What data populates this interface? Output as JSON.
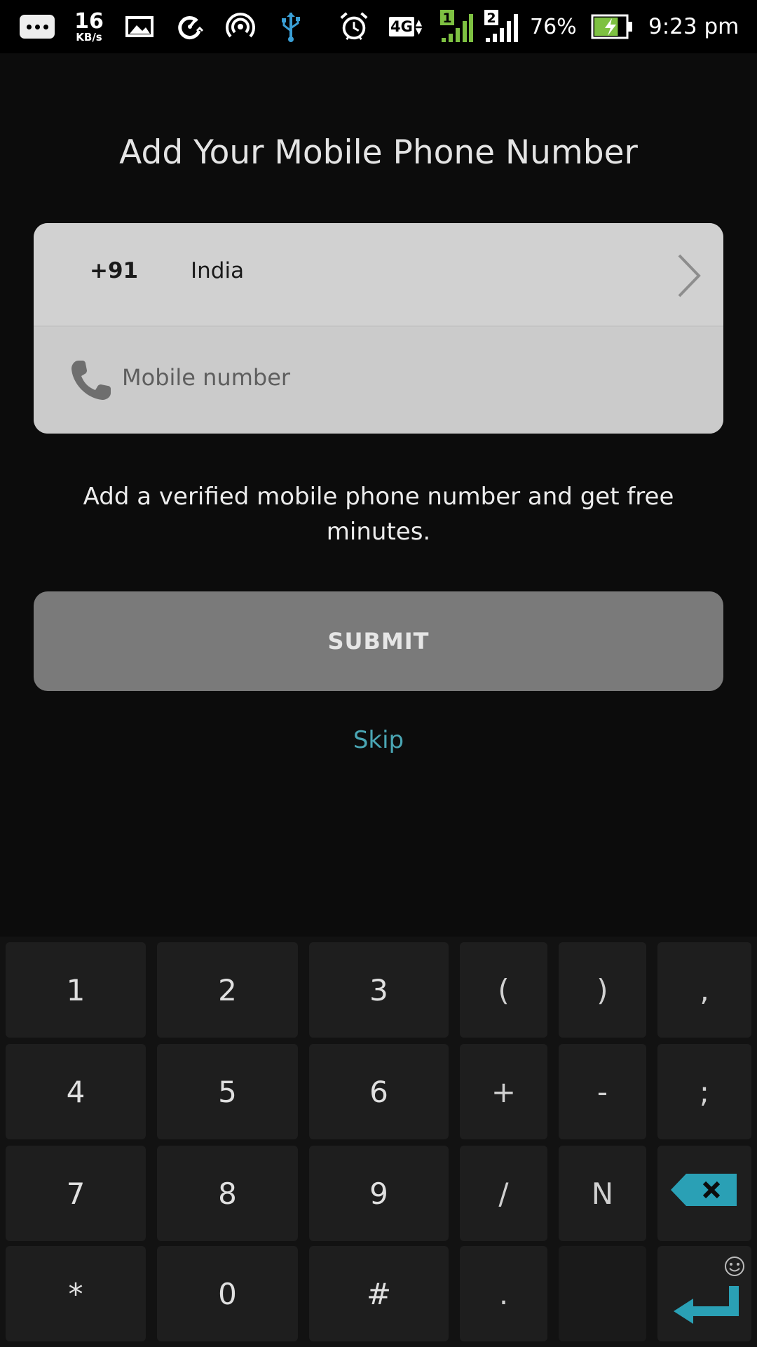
{
  "status_bar": {
    "notification_icon": "more-notifications-icon",
    "net_speed_value": "16",
    "net_speed_unit": "KB/s",
    "icons": [
      "gallery-icon",
      "data-saver-icon",
      "hotspot-icon",
      "usb-icon",
      "alarm-icon"
    ],
    "network_type": "4G",
    "sim1_label": "1",
    "sim2_label": "2",
    "battery_percent": "76%",
    "battery_level": 0.76,
    "time": "9:23 pm",
    "colors": {
      "sim1": "#7ec142",
      "battery": "#7ec142",
      "usb": "#3a9fd6"
    }
  },
  "page": {
    "title": "Add Your Mobile Phone Number",
    "country": {
      "code": "+91",
      "name": "India"
    },
    "mobile_field": {
      "placeholder": "Mobile number",
      "value": ""
    },
    "info_text": "Add a verified mobile phone number and get free minutes.",
    "submit_label": "SUBMIT",
    "skip_label": "Skip",
    "colors": {
      "accent": "#4aa6b4",
      "submit_bg": "#7a7a7a"
    }
  },
  "keyboard": {
    "rows": [
      [
        "1",
        "2",
        "3",
        "(",
        ")",
        ","
      ],
      [
        "4",
        "5",
        "6",
        "+",
        "-",
        ";"
      ],
      [
        "7",
        "8",
        "9",
        "/",
        "N",
        "backspace-icon"
      ],
      [
        "*",
        "0",
        "#",
        ".",
        "",
        "enter-icon"
      ]
    ],
    "emoji_icon": "smiley-icon",
    "colors": {
      "action_key": "#2aa0b5"
    }
  }
}
